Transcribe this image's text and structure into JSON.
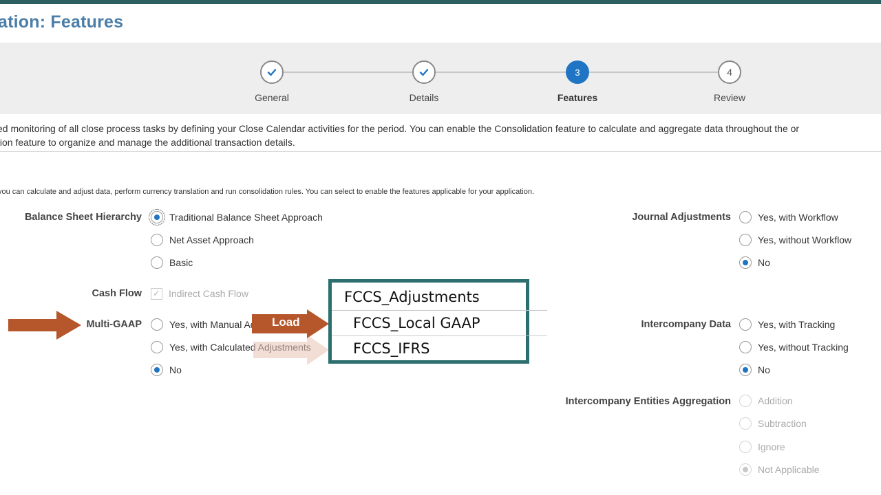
{
  "page": {
    "title": "ation:  Features"
  },
  "train": {
    "steps": [
      {
        "label": "General",
        "number": "",
        "state": "done"
      },
      {
        "label": "Details",
        "number": "",
        "state": "done"
      },
      {
        "label": "Features",
        "number": "3",
        "state": "current"
      },
      {
        "label": "Review",
        "number": "4",
        "state": "future"
      }
    ]
  },
  "intro": {
    "line1": "ed monitoring of all close process tasks by defining your Close Calendar activities for the period. You can enable the Consolidation feature to calculate and aggregate data throughout the or",
    "line2": "tion feature to organize and manage the additional transaction details."
  },
  "consolidation_note": "you can calculate and adjust data, perform currency translation and run consolidation rules. You can select to enable the features applicable for your application.",
  "balance_sheet": {
    "label": "Balance Sheet Hierarchy",
    "options": [
      "Traditional Balance Sheet Approach",
      "Net Asset Approach",
      "Basic"
    ],
    "selected": "Traditional Balance Sheet Approach"
  },
  "cash_flow": {
    "label": "Cash Flow",
    "option": "Indirect Cash Flow",
    "checked": true
  },
  "multi_gaap": {
    "label": "Multi-GAAP",
    "options": [
      "Yes, with Manual Ad",
      "Yes, with Calculated Adjustments",
      "No"
    ],
    "selected": "No"
  },
  "journal_adjustments": {
    "label": "Journal Adjustments",
    "options": [
      "Yes, with Workflow",
      "Yes, without Workflow",
      "No"
    ],
    "selected": "No"
  },
  "intercompany_data": {
    "label": "Intercompany Data",
    "options": [
      "Yes, with Tracking",
      "Yes, without Tracking",
      "No"
    ],
    "selected": "No"
  },
  "intercompany_aggregation": {
    "label": "Intercompany Entities Aggregation",
    "options": [
      "Addition",
      "Subtraction",
      "Ignore",
      "Not Applicable"
    ],
    "selected": "Not Applicable"
  },
  "overlay": {
    "load_label": "Load",
    "members": [
      "FCCS_Adjustments",
      "FCCS_Local GAAP",
      "FCCS_IFRS"
    ],
    "colors": {
      "arrow": "#b5562b",
      "box_border": "#2d6e6e",
      "accent": "#1f75c4"
    }
  }
}
